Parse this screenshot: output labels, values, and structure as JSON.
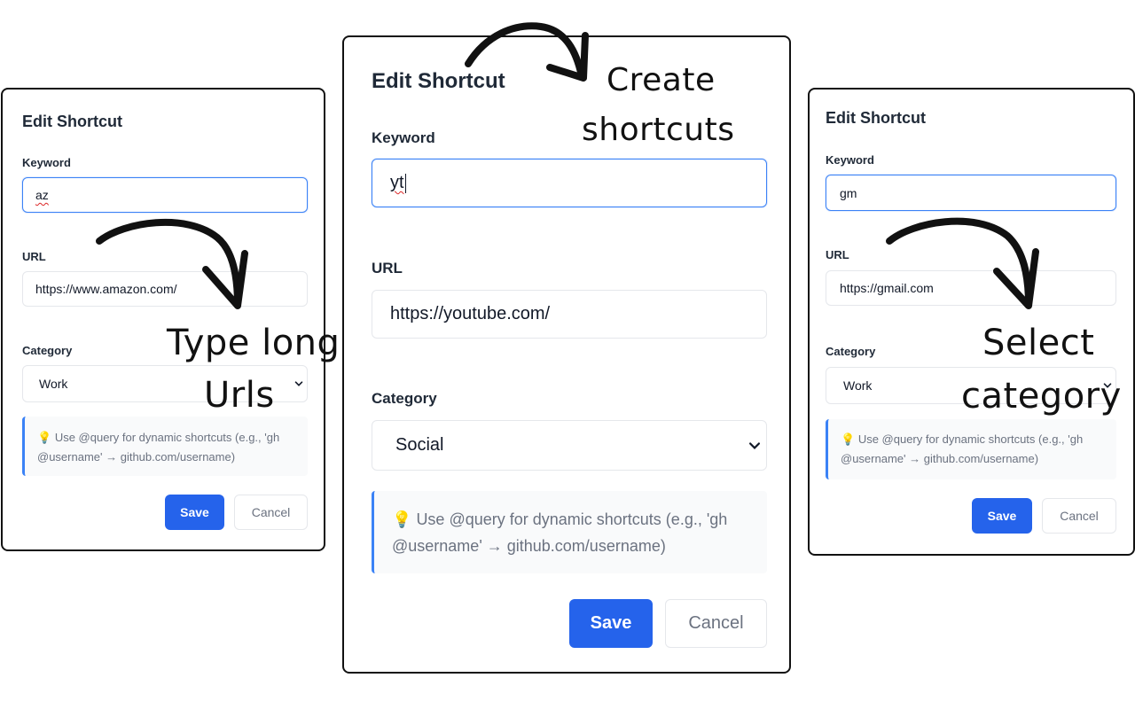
{
  "panels": {
    "left": {
      "title": "Edit Shortcut",
      "keyword_label": "Keyword",
      "keyword_value": "az",
      "url_label": "URL",
      "url_value": "https://www.amazon.com/",
      "category_label": "Category",
      "category_value": "Work",
      "hint": "Use @query for dynamic shortcuts (e.g., 'gh @username' → github.com/username)",
      "save": "Save",
      "cancel": "Cancel"
    },
    "center": {
      "title": "Edit Shortcut",
      "keyword_label": "Keyword",
      "keyword_value": "yt",
      "url_label": "URL",
      "url_value": "https://youtube.com/",
      "category_label": "Category",
      "category_value": "Social",
      "hint": "Use @query for dynamic shortcuts (e.g., 'gh @username' → github.com/username)",
      "save": "Save",
      "cancel": "Cancel"
    },
    "right": {
      "title": "Edit Shortcut",
      "keyword_label": "Keyword",
      "keyword_value": "gm",
      "url_label": "URL",
      "url_value": "https://gmail.com",
      "category_label": "Category",
      "category_value": "Work",
      "hint": "Use @query for dynamic shortcuts (e.g., 'gh @username' → github.com/username)",
      "save": "Save",
      "cancel": "Cancel"
    }
  },
  "annotations": {
    "left_line1": "Type long",
    "left_line2": "Urls",
    "center_line1": "Create",
    "center_line2": "shortcuts",
    "right_line1": "Select",
    "right_line2": "category"
  },
  "icons": {
    "hint": "lightbulb-icon",
    "select": "chevron-down-icon"
  },
  "colors": {
    "primary": "#2563eb",
    "focus_border": "#3b82f6",
    "hint_bg": "#f9fafb",
    "hint_text": "#6b7280",
    "panel_border": "#111111"
  }
}
